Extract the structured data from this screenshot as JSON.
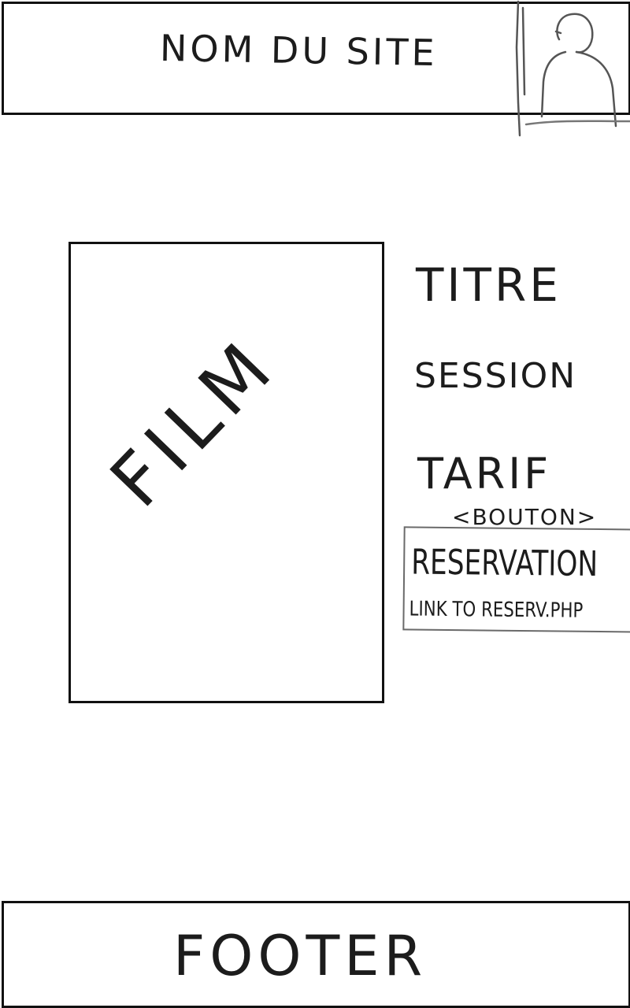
{
  "header": {
    "site_name": "NOM DU SITE",
    "profile_icon": "person-silhouette-icon"
  },
  "film": {
    "poster_label": "FILM",
    "title": "TITRE",
    "session": "SESSION",
    "price": "TARIF"
  },
  "reservation": {
    "hint": "<BOUTON>",
    "button_label": "RESERVATION",
    "link_note": "LINK TO RESERV.PHP"
  },
  "footer": {
    "label": "FOOTER"
  }
}
